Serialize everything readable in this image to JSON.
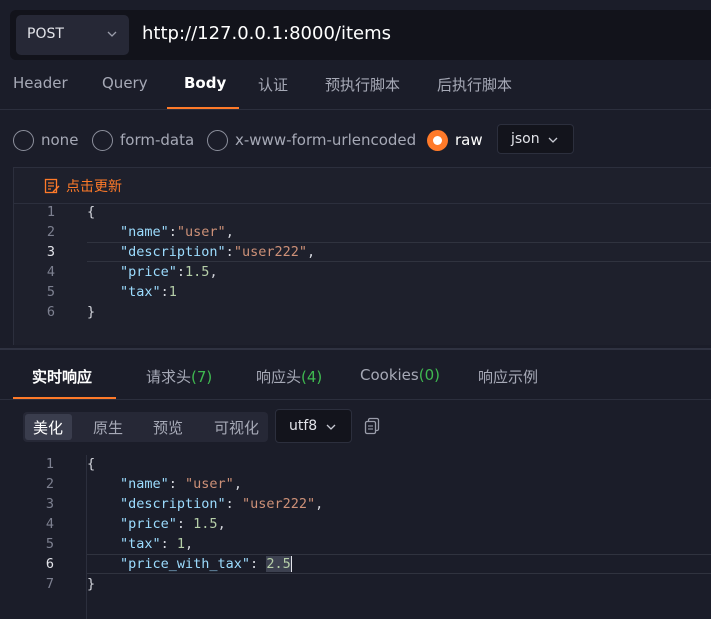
{
  "request": {
    "method": "POST",
    "url": "http://127.0.0.1:8000/items",
    "tabs": [
      "Header",
      "Query",
      "Body",
      "认证",
      "预执行脚本",
      "后执行脚本"
    ],
    "active_tab": "Body",
    "body_types": [
      "none",
      "form-data",
      "x-www-form-urlencoded",
      "raw"
    ],
    "selected_body_type": "raw",
    "format": "json",
    "refresh_label": "点击更新",
    "body_lines": [
      "{",
      "\"name\":\"user\",",
      "\"description\":\"user222\",",
      "\"price\":1.5,",
      "\"tax\":1",
      "}"
    ]
  },
  "response": {
    "tabs": [
      {
        "label": "实时响应",
        "count": ""
      },
      {
        "label": "请求头",
        "count": "(7)"
      },
      {
        "label": "响应头",
        "count": "(4)"
      },
      {
        "label": "Cookies",
        "count": "(0)"
      },
      {
        "label": "响应示例",
        "count": ""
      }
    ],
    "view_modes": [
      "美化",
      "原生",
      "预览",
      "可视化"
    ],
    "active_view_mode": "美化",
    "encoding": "utf8",
    "body_lines": [
      "{",
      "\"name\": \"user\",",
      "\"description\": \"user222\",",
      "\"price\": 1.5,",
      "\"tax\": 1,",
      "\"price_with_tax\": 2.5",
      "}"
    ]
  },
  "line_numbers_request": [
    "1",
    "2",
    "3",
    "4",
    "5",
    "6"
  ],
  "line_numbers_response": [
    "1",
    "2",
    "3",
    "4",
    "5",
    "6",
    "7"
  ],
  "colors": {
    "accent": "#ff7a29",
    "background": "#1b1d29",
    "json_key": "#9cdcfe",
    "json_string": "#ce9178",
    "json_number": "#b5cea8",
    "count_green": "#3fb950"
  },
  "icons": {
    "method_dropdown": "chevron-down-icon",
    "refresh": "edit-document-icon",
    "format_dropdown": "chevron-down-icon",
    "copy": "copy-icon"
  }
}
